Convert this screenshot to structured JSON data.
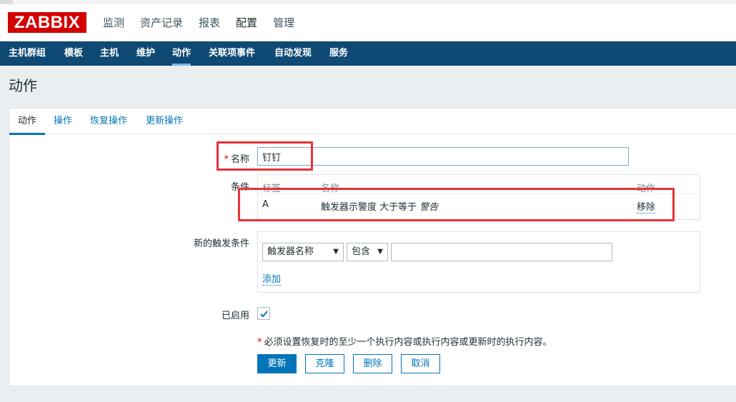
{
  "app": {
    "logo": "ZABBIX"
  },
  "main_menu": [
    {
      "label": "监测"
    },
    {
      "label": "资产记录"
    },
    {
      "label": "报表"
    },
    {
      "label": "配置",
      "selected": true
    },
    {
      "label": "管理"
    }
  ],
  "sub_menu": [
    {
      "label": "主机群组"
    },
    {
      "label": "模板"
    },
    {
      "label": "主机"
    },
    {
      "label": "维护"
    },
    {
      "label": "动作",
      "selected": true
    },
    {
      "label": "关联项事件"
    },
    {
      "label": "自动发现"
    },
    {
      "label": "服务"
    }
  ],
  "page": {
    "title": "动作"
  },
  "tabs": [
    {
      "label": "动作",
      "selected": true
    },
    {
      "label": "操作"
    },
    {
      "label": "恢复操作"
    },
    {
      "label": "更新操作"
    }
  ],
  "form": {
    "name_label": "名称",
    "name_required_mark": "*",
    "name_value": "钉钉",
    "conditions_label": "条件",
    "conditions_headers": {
      "label": "标签",
      "name": "名称",
      "action": "动作"
    },
    "conditions_rows": [
      {
        "label": "A",
        "condition": "触发器示警度 大于等于",
        "value": "警告",
        "action": "移除"
      }
    ],
    "new_condition_label": "新的触发条件",
    "new_condition_type": "触发器名称",
    "new_condition_operator": "包含",
    "new_condition_value": "",
    "add_link": "添加",
    "enabled_label": "已启用",
    "enabled_checked": true,
    "note_mark": "*",
    "note": "必须设置恢复时的至少一个执行内容或执行内容或更新时的执行内容。"
  },
  "buttons": {
    "update": "更新",
    "clone": "克隆",
    "delete": "删除",
    "cancel": "取消"
  },
  "colors": {
    "brand": "#d40000",
    "nav": "#0e4a73",
    "link": "#0275b8",
    "highlight_box": "#e8333a"
  }
}
